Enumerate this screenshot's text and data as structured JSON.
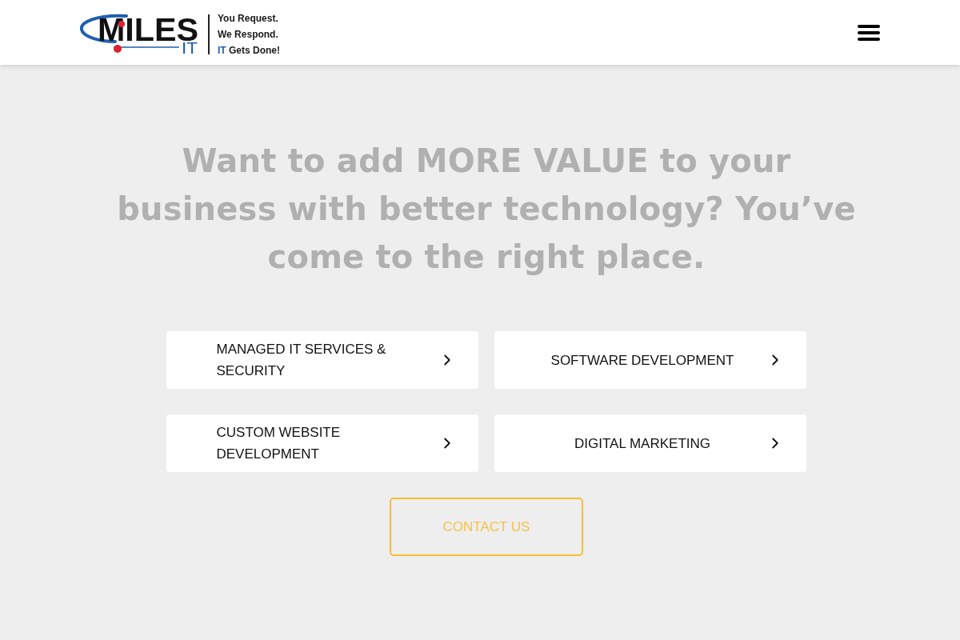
{
  "header": {
    "logo": {
      "wordmark": "MILES",
      "sub_mark": "IT"
    },
    "tagline": [
      {
        "text": "You Request."
      },
      {
        "text": "We Respond."
      },
      {
        "accent": "IT",
        "text": "Gets Done!"
      }
    ]
  },
  "headline": "Want to add MORE VALUE to your business with better technology? You’ve come to the right place.",
  "services": [
    {
      "label": "MANAGED IT SERVICES & SECURITY"
    },
    {
      "label": "SOFTWARE DEVELOPMENT"
    },
    {
      "label": "CUSTOM WEBSITE DEVELOPMENT"
    },
    {
      "label": "DIGITAL MARKETING"
    }
  ],
  "cta": {
    "label": "CONTACT US"
  }
}
